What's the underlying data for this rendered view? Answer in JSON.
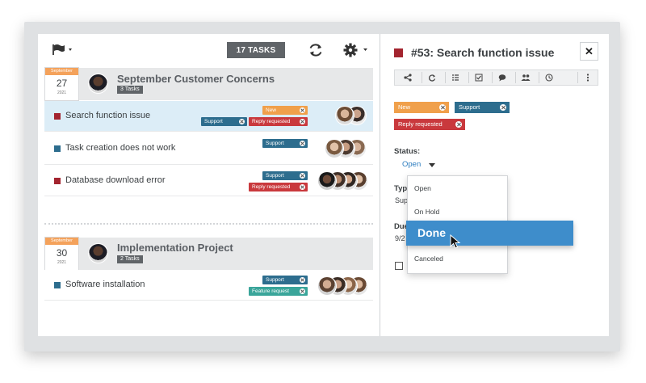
{
  "toolbar": {
    "tasks_count": "17 TASKS",
    "flag_icon": "flag-icon",
    "sync_icon": "refresh-icon",
    "gear_icon": "gear-icon"
  },
  "groups": [
    {
      "month": "September",
      "day": "27",
      "year": "2021",
      "title": "September Customer Concerns",
      "count": "3 Tasks",
      "tasks": [
        {
          "name": "Search function issue",
          "color": "#a3242f",
          "selected": true,
          "tags": [
            "New",
            "Support",
            "Reply requested"
          ]
        },
        {
          "name": "Task creation does not work",
          "color": "#2d6d8e",
          "selected": false,
          "tags": [
            "Support"
          ]
        },
        {
          "name": "Database download error",
          "color": "#a3242f",
          "selected": false,
          "tags": [
            "Support",
            "Reply requested"
          ]
        }
      ]
    },
    {
      "month": "September",
      "day": "30",
      "year": "2021",
      "title": "Implementation Project",
      "count": "2 Tasks",
      "tasks": [
        {
          "name": "Software installation",
          "color": "#2d6d8e",
          "selected": false,
          "tags": [
            "Support",
            "Feature request"
          ]
        }
      ]
    }
  ],
  "detail": {
    "title": "#53: Search function issue",
    "close": "✕",
    "icons": [
      "share-icon",
      "refresh-icon",
      "checklist-icon",
      "checkbox-icon",
      "comment-icon",
      "users-icon",
      "clock-icon",
      "more-icon"
    ],
    "tags": [
      "New",
      "Support",
      "Reply requested"
    ],
    "status_label": "Status:",
    "status_value": "Open",
    "type_label": "Typ",
    "type_value": "Sup",
    "due_label": "Due",
    "due_value": "9/2"
  },
  "dropdown": {
    "items": [
      "Open",
      "On Hold",
      "Done",
      "Canceled"
    ],
    "highlighted": "Done"
  },
  "colors": {
    "new": "#f0a04b",
    "support": "#2d6d8e",
    "reply": "#c9393d",
    "feature": "#3aa59a",
    "accent": "#3e8dcb"
  }
}
